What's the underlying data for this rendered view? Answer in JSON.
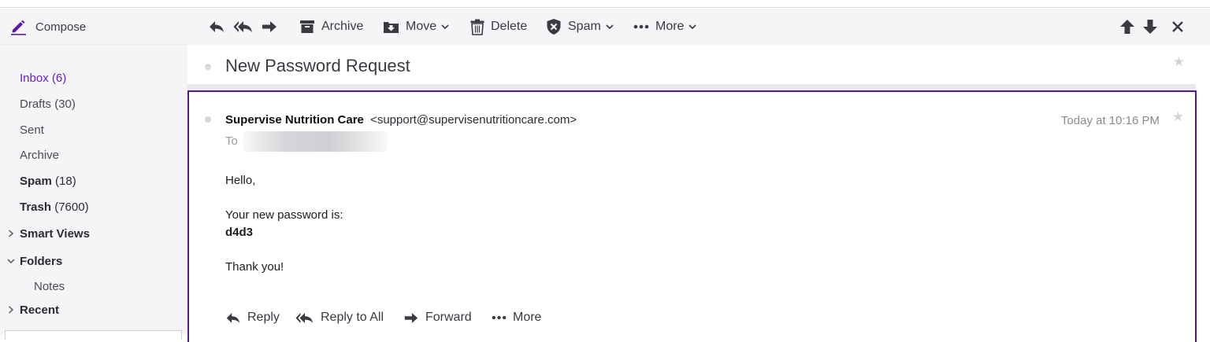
{
  "compose": {
    "label": "Compose",
    "icon": "pencil-icon"
  },
  "sidebar": {
    "items": [
      {
        "label": "Inbox",
        "count": "(6)"
      },
      {
        "label": "Drafts",
        "count": "(30)"
      },
      {
        "label": "Sent"
      },
      {
        "label": "Archive"
      },
      {
        "label": "Spam",
        "count": "(18)"
      },
      {
        "label": "Trash",
        "count": "(7600)"
      },
      {
        "label": "Smart Views"
      },
      {
        "label": "Folders"
      },
      {
        "label": "Notes"
      },
      {
        "label": "Recent"
      }
    ]
  },
  "toolbar": {
    "archive_label": "Archive",
    "move_label": "Move",
    "delete_label": "Delete",
    "spam_label": "Spam",
    "more_label": "More"
  },
  "message": {
    "subject": "New Password Request",
    "sender_name": "Supervise Nutrition Care",
    "sender_email": "<support@supervisenutritioncare.com>",
    "to_label": "To",
    "date": "Today at 10:16 PM",
    "body": {
      "greeting": "Hello,",
      "line1": "Your new password is:",
      "password": "d4d3",
      "closing": "Thank you!"
    }
  },
  "reply_bar": {
    "reply_label": "Reply",
    "reply_all_label": "Reply to All",
    "forward_label": "Forward",
    "more_label": "More"
  },
  "colors": {
    "accent": "#6b1fbf",
    "selection_border": "#4f1a8c",
    "sidebar_bg": "#f5f4f7"
  }
}
